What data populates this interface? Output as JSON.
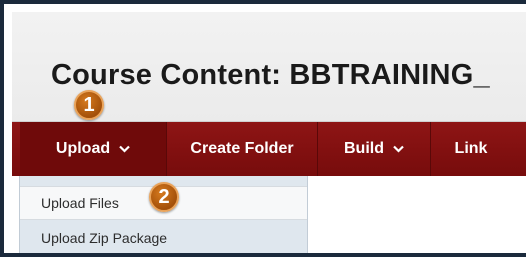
{
  "header": {
    "title": "Course Content: BBTRAINING_"
  },
  "nav": {
    "items": [
      {
        "label": "Upload",
        "has_dropdown": true,
        "active": true
      },
      {
        "label": "Create Folder",
        "has_dropdown": false
      },
      {
        "label": "Build",
        "has_dropdown": true
      },
      {
        "label": "Link",
        "has_dropdown": false
      }
    ]
  },
  "dropdown": {
    "items": [
      {
        "label": "Upload Files",
        "highlighted": true
      },
      {
        "label": "Upload Zip Package",
        "highlighted": false
      }
    ]
  },
  "badges": {
    "step1": "1",
    "step2": "2"
  },
  "colors": {
    "nav_background": "#7f1010",
    "nav_active": "#6f0a0a",
    "dropdown_background": "#dfe7ee",
    "badge": "#c2681a",
    "frame_border": "#1b2a3c"
  },
  "icons": {
    "dropdown_indicator": "chevron-down-icon"
  }
}
